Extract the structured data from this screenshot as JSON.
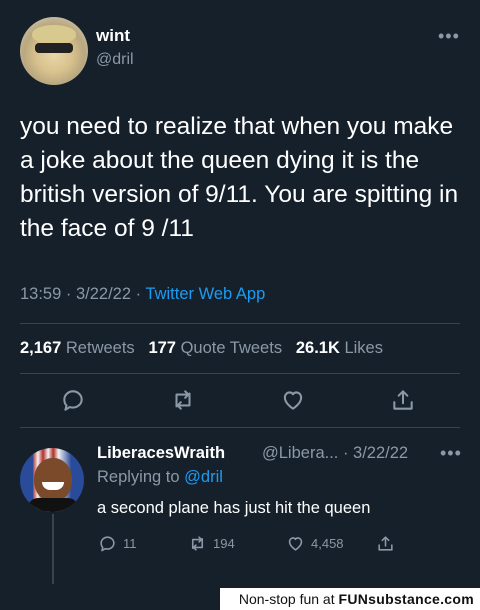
{
  "tweet": {
    "display_name": "wint",
    "handle": "@dril",
    "more_icon": "more-horizontal-icon",
    "text": "you need to realize that when you make a joke about the queen dying it is the british version of 9/11. You are spitting in the face of 9 /11",
    "time": "13:59",
    "date": "3/22/22",
    "app": "Twitter Web App",
    "retweets_count": "2,167",
    "retweets_label": "Retweets",
    "quotes_count": "177",
    "quotes_label": "Quote Tweets",
    "likes_count": "26.1K",
    "likes_label": "Likes"
  },
  "reply": {
    "display_name": "LiberacesWraith",
    "handle_date": "@Libera... · 3/22/22",
    "replying_prefix": "Replying to",
    "replying_mention": "@dril",
    "text": "a second plane has just hit the queen",
    "reply_count": "11",
    "retweet_count": "194",
    "like_count": "4,458"
  },
  "watermark": {
    "prefix": "Non-stop fun at",
    "brand": "FUNsubstance.com"
  },
  "colors": {
    "background": "#15202b",
    "accent": "#1d9bf0",
    "muted": "#8b98a5",
    "divider": "#38444d"
  }
}
